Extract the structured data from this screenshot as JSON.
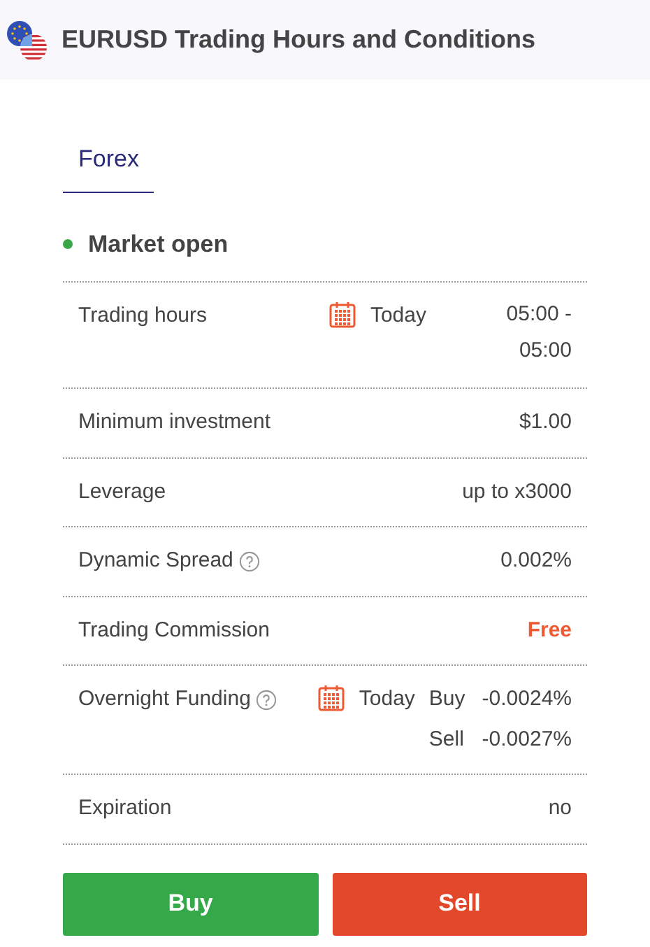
{
  "header": {
    "title": "EURUSD Trading Hours and Conditions"
  },
  "tabs": [
    {
      "label": "Forex",
      "selected": true
    }
  ],
  "status": {
    "label": "Market open",
    "color": "#3aa648"
  },
  "rows": [
    {
      "kind": "schedule",
      "label": "Trading hours",
      "help": false,
      "day": "Today",
      "value": "05:00 - 05:00",
      "accent": false
    },
    {
      "kind": "simple",
      "label": "Minimum investment",
      "help": false,
      "value": "$1.00",
      "accent": false
    },
    {
      "kind": "simple",
      "label": "Leverage",
      "help": false,
      "value": "up to x3000",
      "accent": false
    },
    {
      "kind": "simple",
      "label": "Dynamic Spread",
      "help": true,
      "value": "0.002%",
      "accent": false
    },
    {
      "kind": "simple",
      "label": "Trading Commission",
      "help": false,
      "value": "Free",
      "accent": true
    },
    {
      "kind": "funding",
      "label": "Overnight Funding",
      "help": true,
      "day": "Today",
      "entries": [
        {
          "side": "Buy",
          "value": "-0.0024%"
        },
        {
          "side": "Sell",
          "value": "-0.0027%"
        }
      ],
      "accent": false
    },
    {
      "kind": "simple",
      "label": "Expiration",
      "help": false,
      "value": "no",
      "accent": false
    }
  ],
  "buttons": [
    {
      "label": "Buy",
      "kind": "buy"
    },
    {
      "label": "Sell",
      "kind": "sell"
    }
  ]
}
